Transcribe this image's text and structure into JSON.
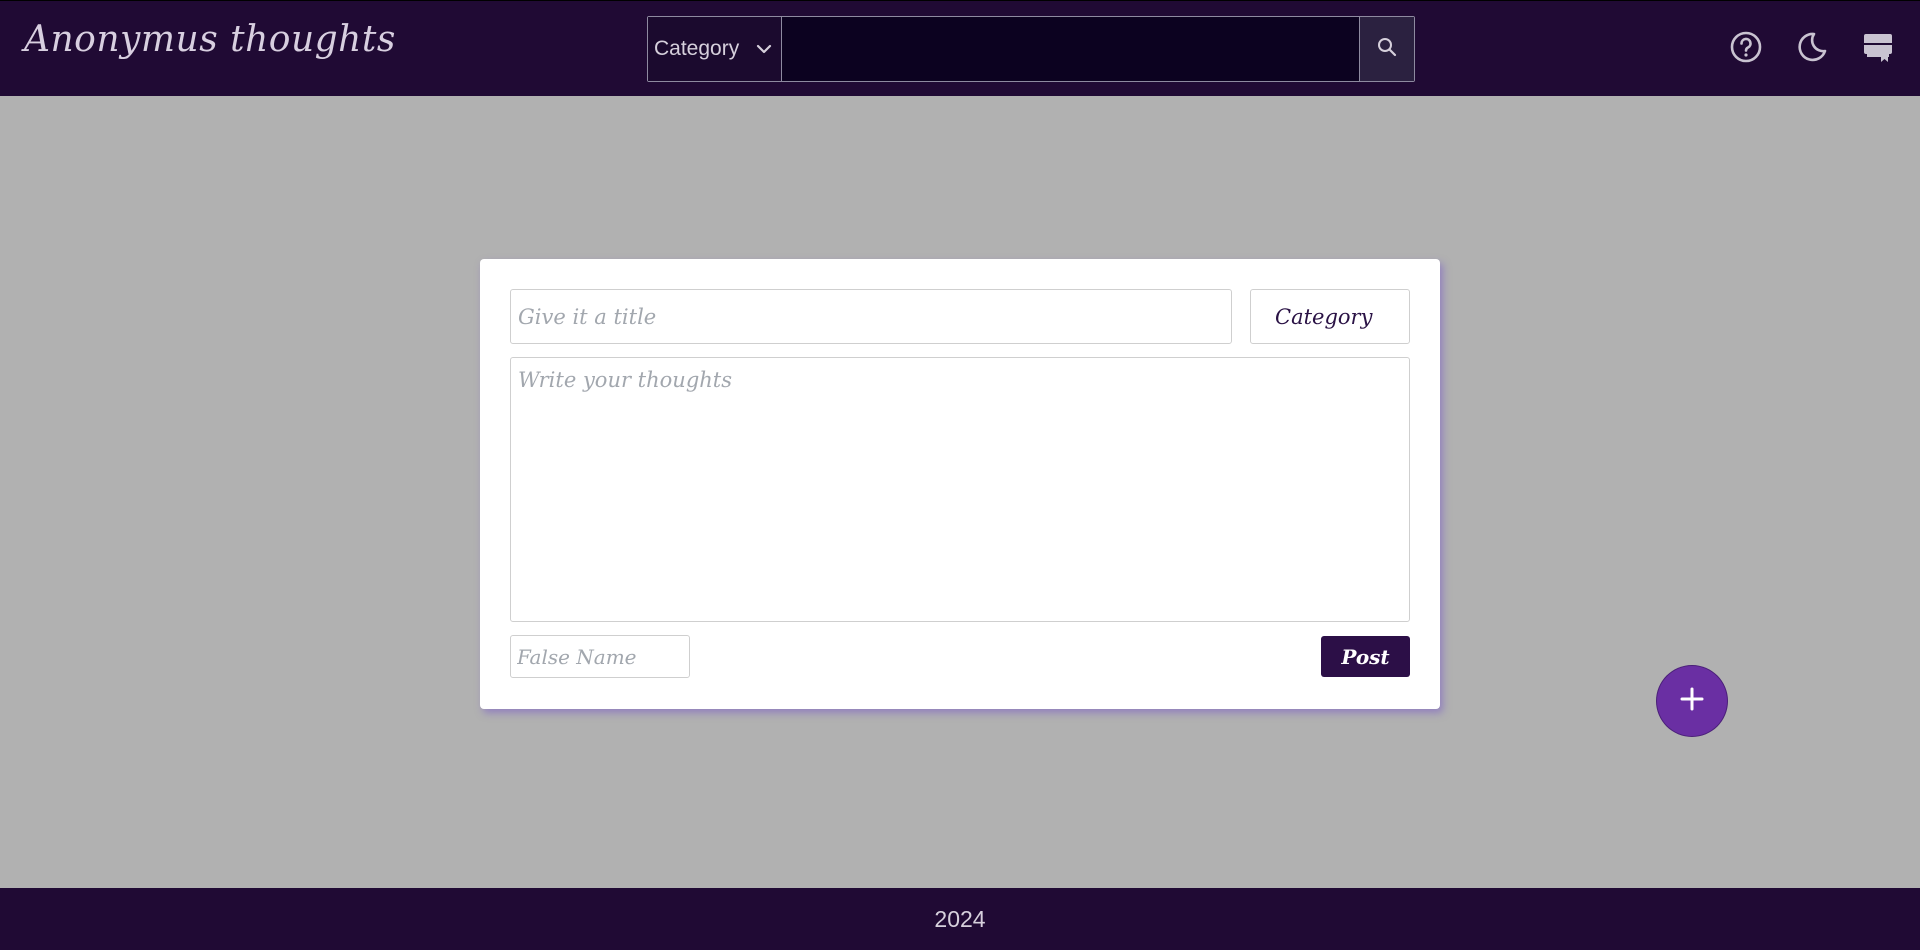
{
  "header": {
    "brand": "Anonymus thoughts",
    "search": {
      "category_label": "Category",
      "query": "",
      "placeholder": ""
    },
    "icons": [
      "help-icon",
      "moon-icon",
      "bookmark-icon"
    ]
  },
  "composer": {
    "title_placeholder": "Give it a title",
    "category_label": "Category",
    "thoughts_placeholder": "Write your thoughts",
    "name_placeholder": "False Name",
    "post_label": "Post"
  },
  "fab": {
    "icon": "plus-icon",
    "label": "+"
  },
  "footer": {
    "text": "2024"
  },
  "colors": {
    "header_bg": "#200a34",
    "page_bg": "#b1b1b1",
    "accent": "#6a2fa3",
    "post_button": "#2c0f47"
  }
}
